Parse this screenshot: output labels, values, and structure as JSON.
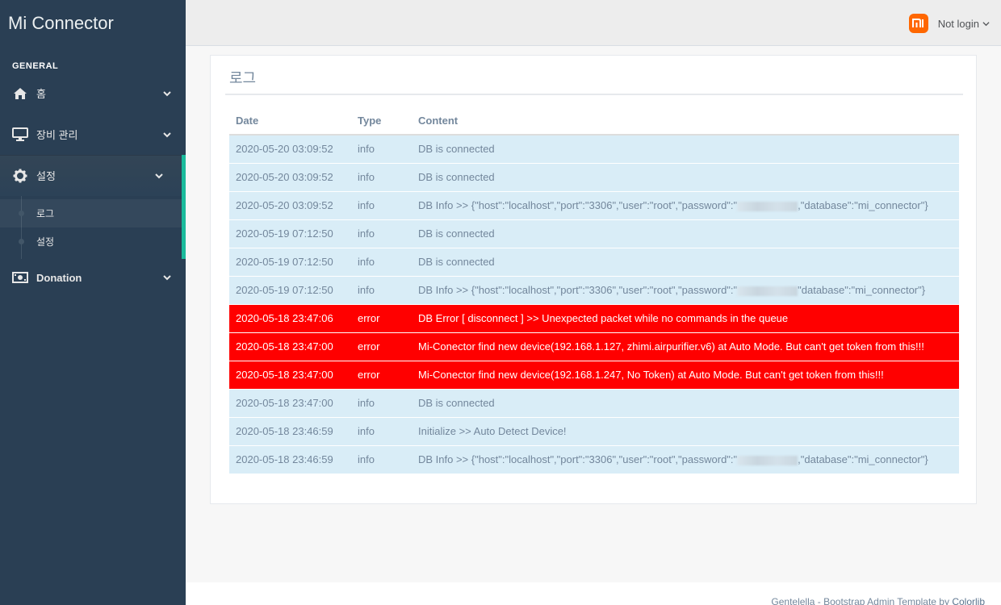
{
  "app": {
    "title": "Mi Connector"
  },
  "sidebar": {
    "section": "GENERAL",
    "items": [
      {
        "label": "홈",
        "icon": "home-icon"
      },
      {
        "label": "장비 관리",
        "icon": "desktop-icon"
      },
      {
        "label": "설정",
        "icon": "gear-icon"
      },
      {
        "label": "Donation",
        "icon": "money-icon"
      }
    ],
    "submenu": [
      {
        "label": "로그"
      },
      {
        "label": "설정"
      }
    ]
  },
  "header": {
    "user_label": "Not login",
    "logo_text": "mi"
  },
  "panel": {
    "title": "로그"
  },
  "table": {
    "headers": [
      "Date",
      "Type",
      "Content"
    ],
    "rows": [
      {
        "date": "2020-05-20 03:09:52",
        "type": "info",
        "content": "DB is connected"
      },
      {
        "date": "2020-05-20 03:09:52",
        "type": "info",
        "content": "DB is connected"
      },
      {
        "date": "2020-05-20 03:09:52",
        "type": "info",
        "content": "DB Info >> {\"host\":\"localhost\",\"port\":\"3306\",\"user\":\"root\",\"password\":\"",
        "content_after": ",\"database\":\"mi_connector\"}",
        "redacted": true
      },
      {
        "date": "2020-05-19 07:12:50",
        "type": "info",
        "content": "DB is connected"
      },
      {
        "date": "2020-05-19 07:12:50",
        "type": "info",
        "content": "DB is connected"
      },
      {
        "date": "2020-05-19 07:12:50",
        "type": "info",
        "content": "DB Info >> {\"host\":\"localhost\",\"port\":\"3306\",\"user\":\"root\",\"password\":\"",
        "content_after": "\"database\":\"mi_connector\"}",
        "redacted": true
      },
      {
        "date": "2020-05-18 23:47:06",
        "type": "error",
        "content": "DB Error [ disconnect ] >> Unexpected packet while no commands in the queue"
      },
      {
        "date": "2020-05-18 23:47:00",
        "type": "error",
        "content": "Mi-Conector find new device(192.168.1.127, zhimi.airpurifier.v6) at Auto Mode. But can't get token from this!!!"
      },
      {
        "date": "2020-05-18 23:47:00",
        "type": "error",
        "content": "Mi-Conector find new device(192.168.1.247, No Token) at Auto Mode. But can't get token from this!!!"
      },
      {
        "date": "2020-05-18 23:47:00",
        "type": "info",
        "content": "DB is connected"
      },
      {
        "date": "2020-05-18 23:46:59",
        "type": "info",
        "content": "Initialize >> Auto Detect Device!"
      },
      {
        "date": "2020-05-18 23:46:59",
        "type": "info",
        "content": "DB Info >> {\"host\":\"localhost\",\"port\":\"3306\",\"user\":\"root\",\"password\":\"",
        "content_after": ",\"database\":\"mi_connector\"}",
        "redacted": true
      }
    ]
  },
  "footer": {
    "text": "Gentelella - Bootstrap Admin Template by ",
    "link": "Colorlib"
  },
  "colors": {
    "sidebar_bg": "#2a3f54",
    "accent": "#1abb9c",
    "info_row": "#d9edf7",
    "error_row": "#ff0000",
    "mi_orange": "#ff6700"
  }
}
